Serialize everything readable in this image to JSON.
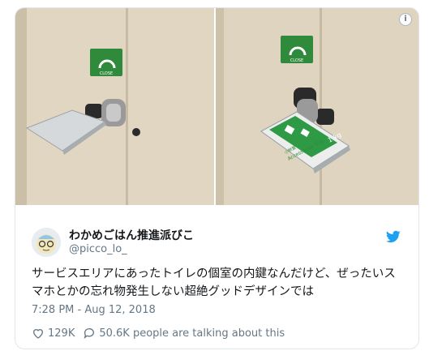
{
  "tweet": {
    "display_name": "わかめごはん推進派びこ",
    "handle": "@picco_lo_",
    "text": "サービスエリアにあったトイレの個室の内鍵なんだけど、ぜったいスマホとかの忘れ物発生しない超絶グッドデザインでは",
    "timestamp": "7:28 PM - Aug 12, 2018",
    "likes": "129K",
    "talking": "50.6K people are talking about this"
  },
  "photo_right": {
    "tray_weight": "1 kg",
    "tray_text_jp": "小物置",
    "tray_text_en": "Accessories Tray",
    "sign_text": "CLOSE"
  },
  "photo_left": {
    "sign_text": "CLOSE"
  },
  "colors": {
    "sign_green": "#2f8a3b",
    "twitter_blue": "#1da1f2",
    "muted": "#657786"
  },
  "icons": [
    "info-icon",
    "twitter-bird-icon",
    "heart-icon",
    "comment-icon"
  ]
}
